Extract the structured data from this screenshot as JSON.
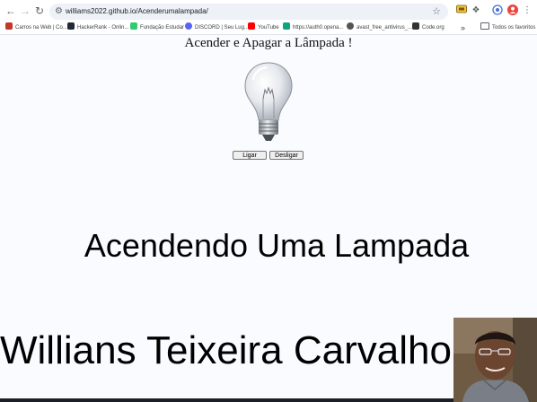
{
  "browser": {
    "url": "williams2022.github.io/Acenderumalampada/",
    "profile_initial": "",
    "bookmarks": [
      {
        "label": "Carros na Web | Co...",
        "color": "#c0392b"
      },
      {
        "label": "HackerRank - Onlin...",
        "color": "#1f2a36"
      },
      {
        "label": "Fundação Estudar",
        "color": "#2ecc71"
      },
      {
        "label": "DISCORD | Seu Lug...",
        "color": "#5865f2"
      },
      {
        "label": "YouTube",
        "color": "#ff0000"
      },
      {
        "label": "https://auth0.opena...",
        "color": "#10a37f"
      },
      {
        "label": "avast_free_antivirus_...",
        "color": "#555555"
      },
      {
        "label": "Code.org",
        "color": "#333333"
      }
    ],
    "more_bookmarks": "»",
    "all_bookmarks": "Todos os favoritos"
  },
  "page": {
    "title": "Acender e Apagar a Lâmpada !",
    "bulb_icon": "light-bulb-off",
    "buttons": {
      "on": "Ligar",
      "off": "Desligar"
    },
    "heading": "Acendendo Uma Lampada",
    "author": "Willians Teixeira Carvalho"
  },
  "colors": {
    "background": "#fafbff",
    "omnibox": "#eef1f7",
    "profile_badge": "#e8453c"
  }
}
